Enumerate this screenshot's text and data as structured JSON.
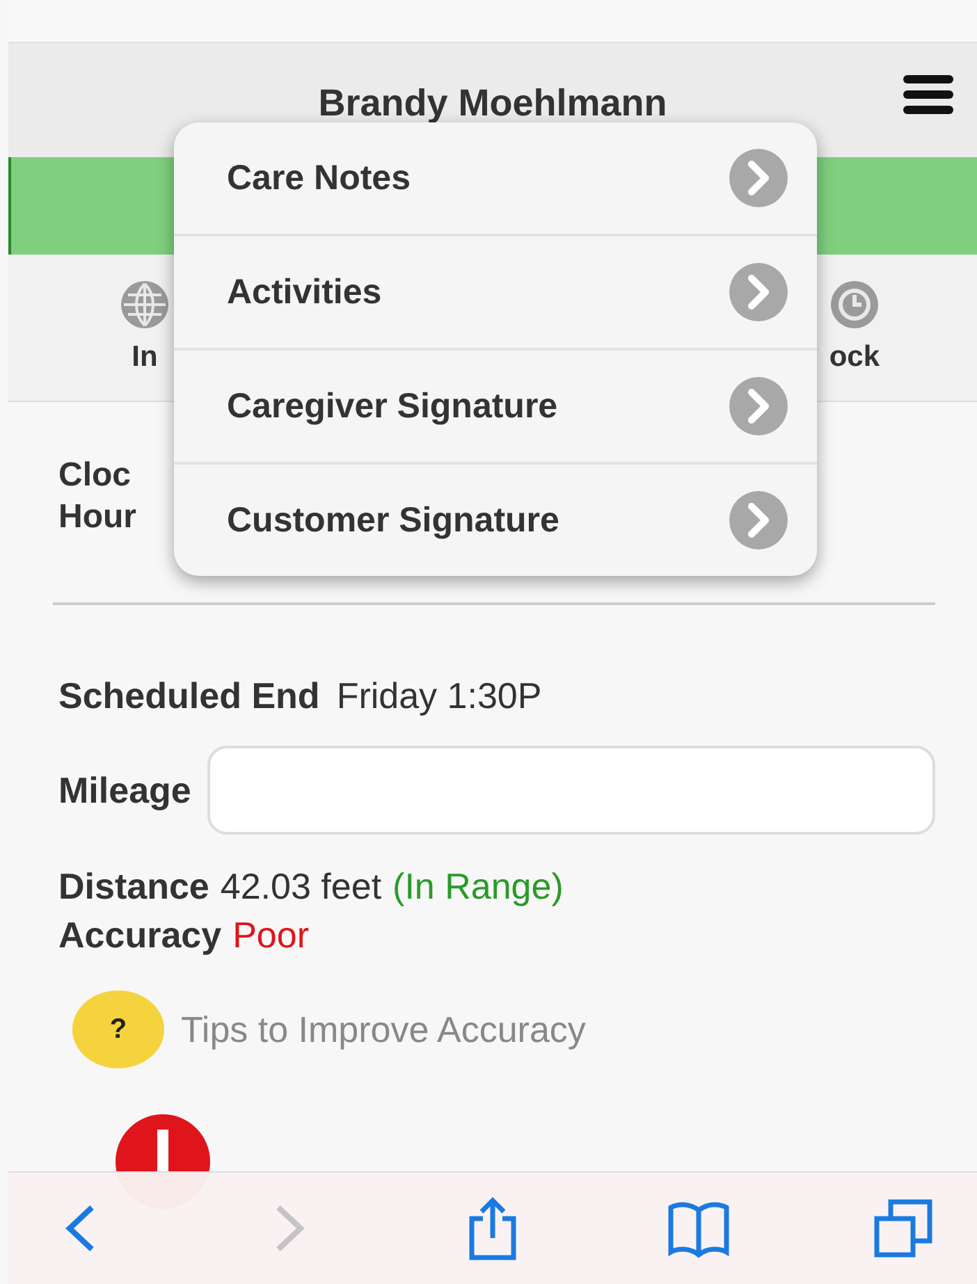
{
  "header": {
    "title": "Brandy Moehlmann"
  },
  "tabs": [
    {
      "kind": "globe",
      "label": "In"
    },
    {
      "kind": "clock",
      "label": "ock"
    }
  ],
  "menu": {
    "items": [
      {
        "label": "Care Notes"
      },
      {
        "label": "Activities"
      },
      {
        "label": "Caregiver Signature"
      },
      {
        "label": "Customer Signature"
      }
    ]
  },
  "clock_lines": [
    "Cloc",
    "Hour"
  ],
  "scheduled_end": {
    "label": "Scheduled End",
    "value": "Friday 1:30P"
  },
  "mileage": {
    "label": "Mileage"
  },
  "distance": {
    "label": "Distance",
    "value": "42.03 feet",
    "status": "(In Range)"
  },
  "accuracy": {
    "label": "Accuracy",
    "value": "Poor"
  },
  "tips": {
    "icon_text": "?",
    "label": "Tips to Improve Accuracy"
  },
  "toolbar": [
    {
      "kind": "back",
      "disabled": false
    },
    {
      "kind": "forward",
      "disabled": true
    },
    {
      "kind": "share",
      "disabled": false
    },
    {
      "kind": "bookmarks",
      "disabled": false
    },
    {
      "kind": "tabs",
      "disabled": false
    }
  ]
}
